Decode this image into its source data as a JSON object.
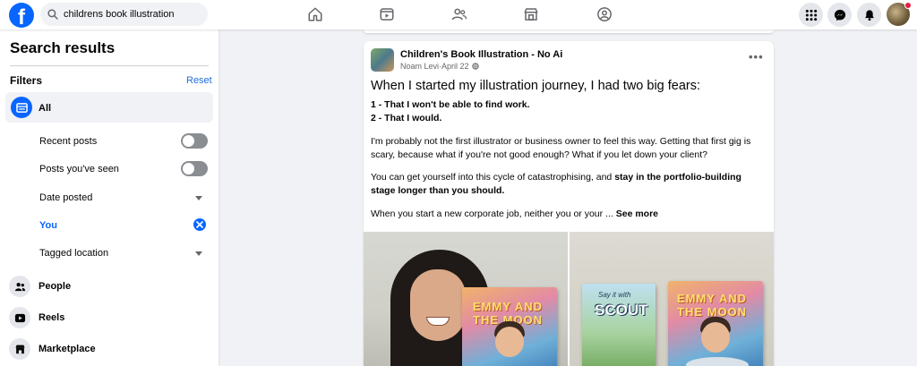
{
  "topbar": {
    "logo_letter": "f",
    "search_query": "childrens book illustration",
    "nav_icons": [
      "home-icon",
      "video-icon",
      "friends-icon",
      "marketplace-icon",
      "groups-icon"
    ],
    "right_icons": [
      "menu-grid-icon",
      "messenger-icon",
      "notifications-icon"
    ],
    "accent": "#0866ff"
  },
  "sidebar": {
    "title": "Search results",
    "filters_label": "Filters",
    "reset_label": "Reset",
    "all_label": "All",
    "filters": [
      {
        "label": "Recent posts",
        "control": "toggle",
        "on": false
      },
      {
        "label": "Posts you've seen",
        "control": "toggle",
        "on": false
      },
      {
        "label": "Date posted",
        "control": "dropdown"
      },
      {
        "label": "You",
        "control": "clear",
        "active": true
      },
      {
        "label": "Tagged location",
        "control": "dropdown"
      }
    ],
    "categories": [
      {
        "label": "People",
        "icon": "people-icon"
      },
      {
        "label": "Reels",
        "icon": "reels-icon"
      },
      {
        "label": "Marketplace",
        "icon": "marketplace-icon"
      }
    ]
  },
  "post": {
    "group_name": "Children's Book Illustration - No Ai",
    "author": "Noam Levi",
    "date": "April 22",
    "separator": " · ",
    "heading": "When I started my illustration journey, I had two big fears:",
    "fear_1": "1 - That I won't be able to find work.",
    "fear_2": "2 - That I would.",
    "paragraph_1": "I'm probably not the first illustrator or business owner to feel this way. Getting that first gig is scary, because what if you're not good enough? What if you let down your client?",
    "paragraph_2_start": "You can get yourself into this cycle of catastrophising, and ",
    "paragraph_2_bold": "stay in the portfolio-building stage longer than you should.",
    "paragraph_3": "When you start a new corporate job, neither you or your ... ",
    "see_more": "See more",
    "photos": [
      {
        "description_icon": "photo",
        "book_title": "EMMY AND THE MOON"
      },
      {
        "book_subtitle": "Say it with",
        "book_title": "SCOUT",
        "second_book_title": "EMMY AND THE MOON"
      }
    ]
  }
}
